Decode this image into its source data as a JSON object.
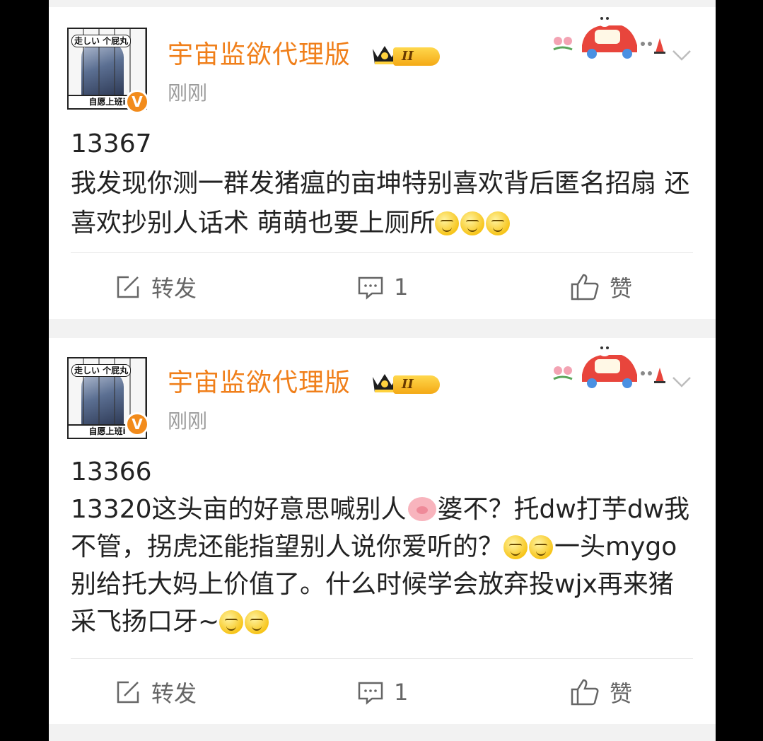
{
  "posts": [
    {
      "username": "宇宙监欲代理版",
      "vip_level": "II",
      "time": "刚刚",
      "avatar": {
        "bubble": "走しい 个屁丸",
        "caption": "自愿上班i"
      },
      "verified_badge": "V",
      "lines": [
        "13367",
        "我发现你测一群发猪瘟的亩坤特别喜欢背后匿名招扇 还喜欢抄别人话术 萌萌也要上厕所"
      ],
      "emoji_count": 3,
      "actions": {
        "repost": "转发",
        "comment": "1",
        "like": "赞"
      }
    },
    {
      "username": "宇宙监欲代理版",
      "vip_level": "II",
      "time": "刚刚",
      "avatar": {
        "bubble": "走しい 个屁丸",
        "caption": "自愿上班i"
      },
      "verified_badge": "V",
      "line1": "13366",
      "seg_a": "13320这头亩的好意思喊别人",
      "seg_b": "婆不？托dw打芋dw我不管，拐虎还能指望别人说你爱听的？",
      "seg_c": "一头mygo别给托大妈上价值了。什么时候学会放弃投wjx再来猪采飞扬口牙~",
      "actions": {
        "repost": "转发",
        "comment": "1",
        "like": "赞"
      }
    }
  ],
  "icons": [
    "avatar",
    "verified-v-icon",
    "vip-crown-icon",
    "car-decoration-icon",
    "chevron-down-icon",
    "repost-icon",
    "comment-icon",
    "like-icon",
    "smile-emoji-icon",
    "pig-emoji-icon"
  ],
  "colors": {
    "username": "#f07f1a",
    "time": "#9b9b9b",
    "text": "#222222",
    "action": "#666666",
    "feed_bg": "#f2f2f2"
  }
}
